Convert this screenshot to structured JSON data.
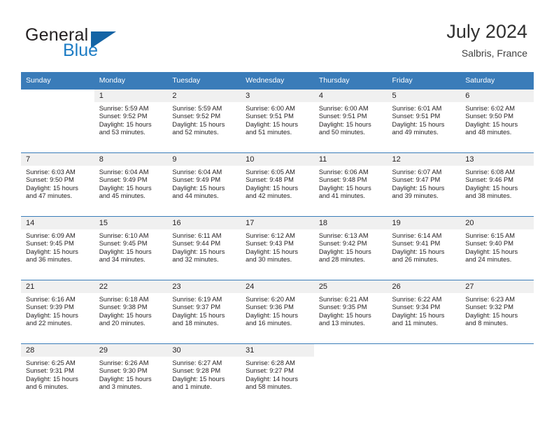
{
  "brand": {
    "name_top": "General",
    "name_bottom": "Blue",
    "accent_color": "#1d7cc4",
    "flag_color": "#1464a5"
  },
  "header": {
    "title": "July 2024",
    "subtitle": "Salbris, France",
    "header_bg": "#3a7cb9",
    "daynum_bg": "#f0f0f0"
  },
  "weekdays": [
    "Sunday",
    "Monday",
    "Tuesday",
    "Wednesday",
    "Thursday",
    "Friday",
    "Saturday"
  ],
  "labels": {
    "sunrise": "Sunrise:",
    "sunset": "Sunset:",
    "daylight": "Daylight:"
  },
  "weeks": [
    [
      {
        "day": ""
      },
      {
        "day": "1",
        "sunrise": "Sunrise: 5:59 AM",
        "sunset": "Sunset: 9:52 PM",
        "daylight_1": "Daylight: 15 hours",
        "daylight_2": "and 53 minutes."
      },
      {
        "day": "2",
        "sunrise": "Sunrise: 5:59 AM",
        "sunset": "Sunset: 9:52 PM",
        "daylight_1": "Daylight: 15 hours",
        "daylight_2": "and 52 minutes."
      },
      {
        "day": "3",
        "sunrise": "Sunrise: 6:00 AM",
        "sunset": "Sunset: 9:51 PM",
        "daylight_1": "Daylight: 15 hours",
        "daylight_2": "and 51 minutes."
      },
      {
        "day": "4",
        "sunrise": "Sunrise: 6:00 AM",
        "sunset": "Sunset: 9:51 PM",
        "daylight_1": "Daylight: 15 hours",
        "daylight_2": "and 50 minutes."
      },
      {
        "day": "5",
        "sunrise": "Sunrise: 6:01 AM",
        "sunset": "Sunset: 9:51 PM",
        "daylight_1": "Daylight: 15 hours",
        "daylight_2": "and 49 minutes."
      },
      {
        "day": "6",
        "sunrise": "Sunrise: 6:02 AM",
        "sunset": "Sunset: 9:50 PM",
        "daylight_1": "Daylight: 15 hours",
        "daylight_2": "and 48 minutes."
      }
    ],
    [
      {
        "day": "7",
        "sunrise": "Sunrise: 6:03 AM",
        "sunset": "Sunset: 9:50 PM",
        "daylight_1": "Daylight: 15 hours",
        "daylight_2": "and 47 minutes."
      },
      {
        "day": "8",
        "sunrise": "Sunrise: 6:04 AM",
        "sunset": "Sunset: 9:49 PM",
        "daylight_1": "Daylight: 15 hours",
        "daylight_2": "and 45 minutes."
      },
      {
        "day": "9",
        "sunrise": "Sunrise: 6:04 AM",
        "sunset": "Sunset: 9:49 PM",
        "daylight_1": "Daylight: 15 hours",
        "daylight_2": "and 44 minutes."
      },
      {
        "day": "10",
        "sunrise": "Sunrise: 6:05 AM",
        "sunset": "Sunset: 9:48 PM",
        "daylight_1": "Daylight: 15 hours",
        "daylight_2": "and 42 minutes."
      },
      {
        "day": "11",
        "sunrise": "Sunrise: 6:06 AM",
        "sunset": "Sunset: 9:48 PM",
        "daylight_1": "Daylight: 15 hours",
        "daylight_2": "and 41 minutes."
      },
      {
        "day": "12",
        "sunrise": "Sunrise: 6:07 AM",
        "sunset": "Sunset: 9:47 PM",
        "daylight_1": "Daylight: 15 hours",
        "daylight_2": "and 39 minutes."
      },
      {
        "day": "13",
        "sunrise": "Sunrise: 6:08 AM",
        "sunset": "Sunset: 9:46 PM",
        "daylight_1": "Daylight: 15 hours",
        "daylight_2": "and 38 minutes."
      }
    ],
    [
      {
        "day": "14",
        "sunrise": "Sunrise: 6:09 AM",
        "sunset": "Sunset: 9:45 PM",
        "daylight_1": "Daylight: 15 hours",
        "daylight_2": "and 36 minutes."
      },
      {
        "day": "15",
        "sunrise": "Sunrise: 6:10 AM",
        "sunset": "Sunset: 9:45 PM",
        "daylight_1": "Daylight: 15 hours",
        "daylight_2": "and 34 minutes."
      },
      {
        "day": "16",
        "sunrise": "Sunrise: 6:11 AM",
        "sunset": "Sunset: 9:44 PM",
        "daylight_1": "Daylight: 15 hours",
        "daylight_2": "and 32 minutes."
      },
      {
        "day": "17",
        "sunrise": "Sunrise: 6:12 AM",
        "sunset": "Sunset: 9:43 PM",
        "daylight_1": "Daylight: 15 hours",
        "daylight_2": "and 30 minutes."
      },
      {
        "day": "18",
        "sunrise": "Sunrise: 6:13 AM",
        "sunset": "Sunset: 9:42 PM",
        "daylight_1": "Daylight: 15 hours",
        "daylight_2": "and 28 minutes."
      },
      {
        "day": "19",
        "sunrise": "Sunrise: 6:14 AM",
        "sunset": "Sunset: 9:41 PM",
        "daylight_1": "Daylight: 15 hours",
        "daylight_2": "and 26 minutes."
      },
      {
        "day": "20",
        "sunrise": "Sunrise: 6:15 AM",
        "sunset": "Sunset: 9:40 PM",
        "daylight_1": "Daylight: 15 hours",
        "daylight_2": "and 24 minutes."
      }
    ],
    [
      {
        "day": "21",
        "sunrise": "Sunrise: 6:16 AM",
        "sunset": "Sunset: 9:39 PM",
        "daylight_1": "Daylight: 15 hours",
        "daylight_2": "and 22 minutes."
      },
      {
        "day": "22",
        "sunrise": "Sunrise: 6:18 AM",
        "sunset": "Sunset: 9:38 PM",
        "daylight_1": "Daylight: 15 hours",
        "daylight_2": "and 20 minutes."
      },
      {
        "day": "23",
        "sunrise": "Sunrise: 6:19 AM",
        "sunset": "Sunset: 9:37 PM",
        "daylight_1": "Daylight: 15 hours",
        "daylight_2": "and 18 minutes."
      },
      {
        "day": "24",
        "sunrise": "Sunrise: 6:20 AM",
        "sunset": "Sunset: 9:36 PM",
        "daylight_1": "Daylight: 15 hours",
        "daylight_2": "and 16 minutes."
      },
      {
        "day": "25",
        "sunrise": "Sunrise: 6:21 AM",
        "sunset": "Sunset: 9:35 PM",
        "daylight_1": "Daylight: 15 hours",
        "daylight_2": "and 13 minutes."
      },
      {
        "day": "26",
        "sunrise": "Sunrise: 6:22 AM",
        "sunset": "Sunset: 9:34 PM",
        "daylight_1": "Daylight: 15 hours",
        "daylight_2": "and 11 minutes."
      },
      {
        "day": "27",
        "sunrise": "Sunrise: 6:23 AM",
        "sunset": "Sunset: 9:32 PM",
        "daylight_1": "Daylight: 15 hours",
        "daylight_2": "and 8 minutes."
      }
    ],
    [
      {
        "day": "28",
        "sunrise": "Sunrise: 6:25 AM",
        "sunset": "Sunset: 9:31 PM",
        "daylight_1": "Daylight: 15 hours",
        "daylight_2": "and 6 minutes."
      },
      {
        "day": "29",
        "sunrise": "Sunrise: 6:26 AM",
        "sunset": "Sunset: 9:30 PM",
        "daylight_1": "Daylight: 15 hours",
        "daylight_2": "and 3 minutes."
      },
      {
        "day": "30",
        "sunrise": "Sunrise: 6:27 AM",
        "sunset": "Sunset: 9:28 PM",
        "daylight_1": "Daylight: 15 hours",
        "daylight_2": "and 1 minute."
      },
      {
        "day": "31",
        "sunrise": "Sunrise: 6:28 AM",
        "sunset": "Sunset: 9:27 PM",
        "daylight_1": "Daylight: 14 hours",
        "daylight_2": "and 58 minutes."
      },
      {
        "day": ""
      },
      {
        "day": ""
      },
      {
        "day": ""
      }
    ]
  ]
}
